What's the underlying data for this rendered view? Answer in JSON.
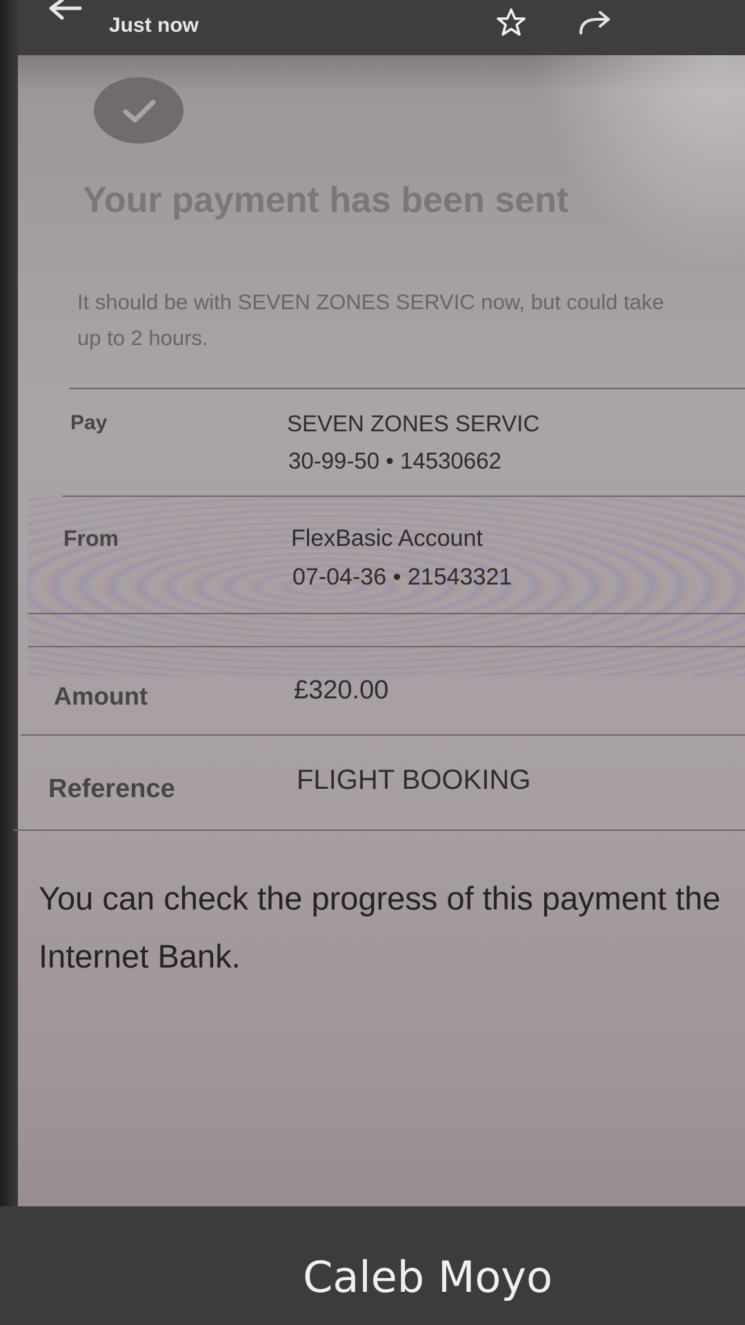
{
  "header": {
    "timestamp": "Just now",
    "back_icon": "arrow-left-icon",
    "star_icon": "star-outline-icon",
    "forward_icon": "forward-icon"
  },
  "confirmation": {
    "check_icon": "checkmark-circle-icon",
    "headline": "Your payment has been sent",
    "subtext": "It should be with SEVEN ZONES SERVIC now, but could take up to 2 hours."
  },
  "details": {
    "pay": {
      "label": "Pay",
      "name": "SEVEN ZONES SERVIC",
      "account": "30-99-50 • 14530662"
    },
    "from": {
      "label": "From",
      "name": "FlexBasic Account",
      "account": "07-04-36 • 21543321"
    },
    "amount": {
      "label": "Amount",
      "value": "£320.00"
    },
    "reference": {
      "label": "Reference",
      "value": "FLIGHT BOOKING"
    }
  },
  "footer_note": "You can check the progress of this payment the Internet Bank.",
  "caption": {
    "name": "Caleb Moyo"
  },
  "colors": {
    "header_bg": "#3f3d40",
    "screen_bg": "#aaa4a8",
    "caption_bg": "#3d3b3e",
    "text_dark": "#262225"
  }
}
